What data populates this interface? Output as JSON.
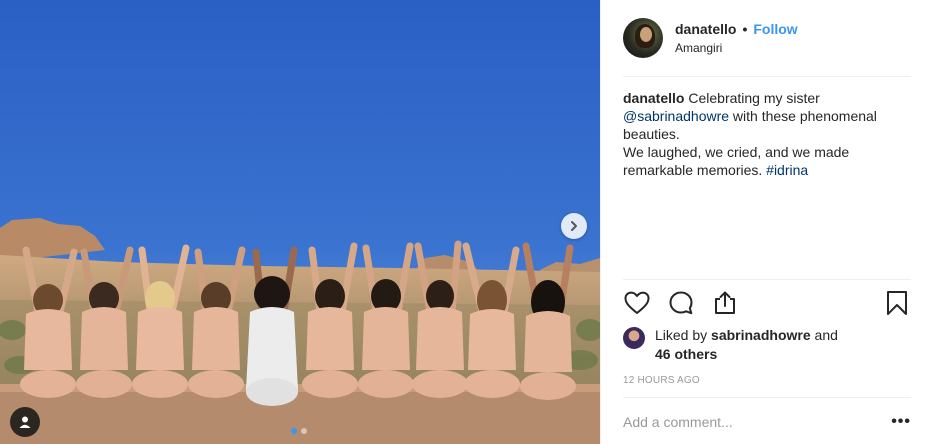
{
  "post": {
    "author": {
      "username": "danatello",
      "location": "Amangiri",
      "follow_label": "Follow",
      "separator": "•"
    },
    "caption": {
      "username": "danatello",
      "text_1": " Celebrating my sister ",
      "mention": "@sabrinadhowre",
      "text_2": " with these phenomenal beauties.",
      "line_2": "We laughed, we cried, and we made remarkable memories. ",
      "hashtag": "#idrina"
    },
    "likes": {
      "prefix": "Liked by ",
      "liker": "sabrinadhowre",
      "conjunction": " and",
      "others": "46 others"
    },
    "timestamp": "12 hours ago",
    "comment": {
      "placeholder": "Add a comment...",
      "more_label": "•••"
    },
    "carousel": {
      "slide_count": 2,
      "active_index": 0
    },
    "icons": {
      "like": "heart-icon",
      "comment": "comment-bubble-icon",
      "share": "share-icon",
      "save": "bookmark-icon",
      "next": "chevron-right-icon",
      "tags": "user-tag-icon"
    },
    "colors": {
      "link_blue": "#3897f0",
      "mention_blue": "#003569",
      "text": "#262626",
      "muted": "#999999",
      "sky": "#2f63c4"
    }
  }
}
